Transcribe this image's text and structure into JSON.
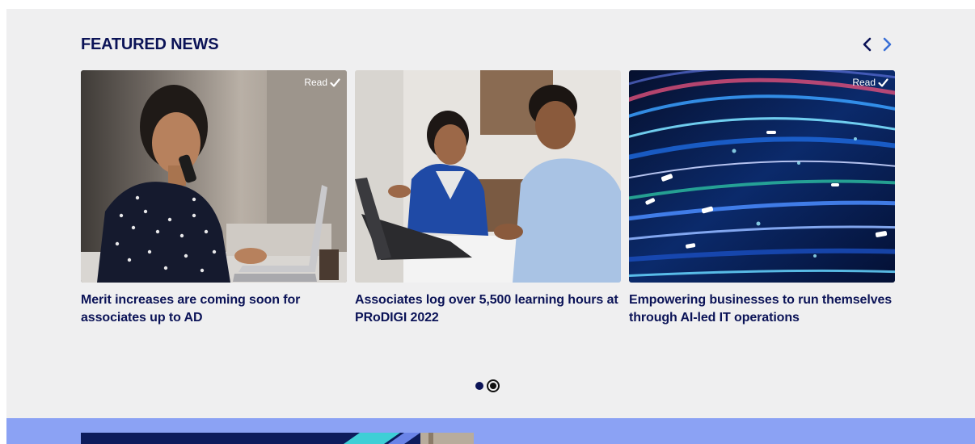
{
  "section": {
    "title": "FEATURED NEWS",
    "prev_icon": "chevron-left-icon",
    "next_icon": "chevron-right-icon"
  },
  "cards": [
    {
      "title": "Merit increases are coming soon for associates up to AD",
      "read_label": "Read",
      "image": "woman-on-phone-with-laptop-photo"
    },
    {
      "title": "Associates log over 5,500 learning hours at PRoDIGI 2022",
      "read_label": "",
      "image": "two-colleagues-discussing-at-laptop-photo"
    },
    {
      "title": "Empowering businesses to run themselves through AI-led IT operations",
      "read_label": "Read",
      "image": "abstract-blue-light-streams-photo"
    }
  ],
  "pagination": {
    "count": 2,
    "active_index": 1
  },
  "colors": {
    "title_navy": "#0b1357",
    "section_bg": "#efeff0",
    "band_blue": "#8ba2f4"
  }
}
